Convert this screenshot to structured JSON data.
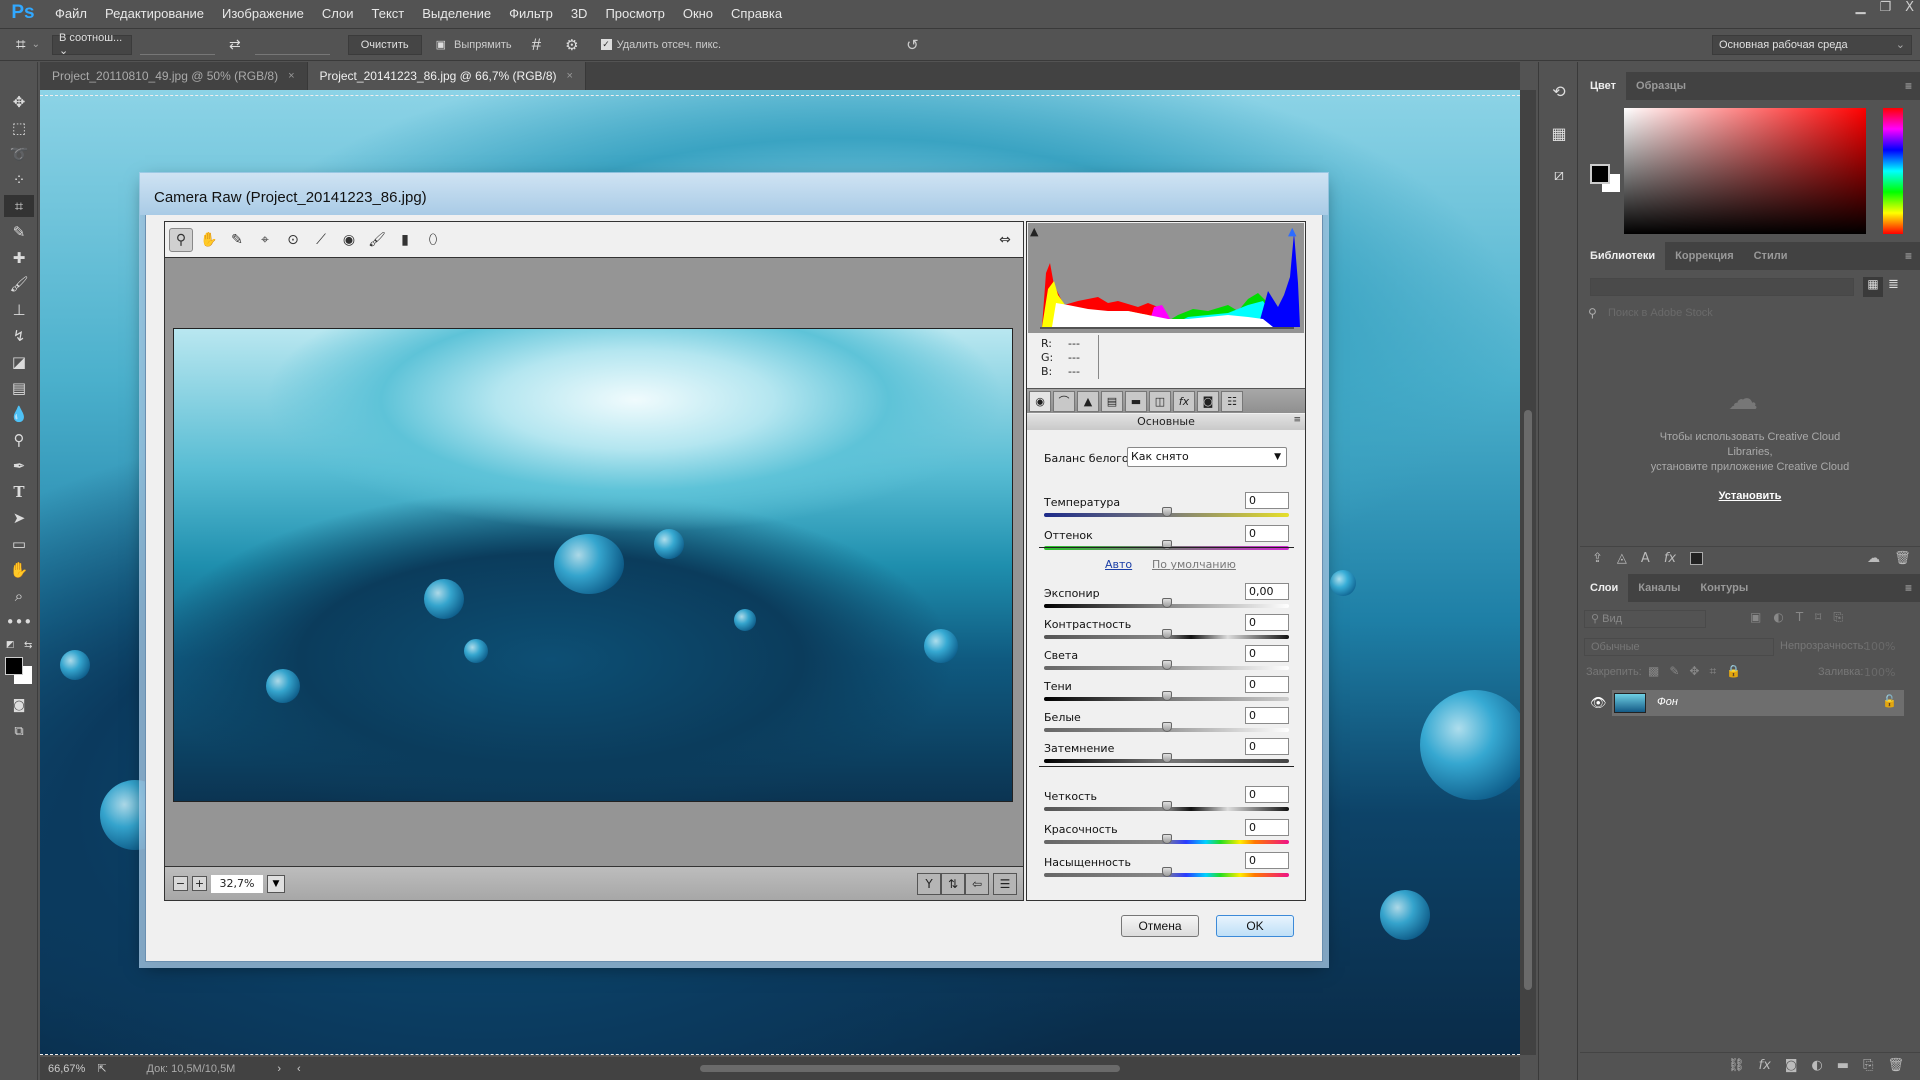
{
  "app": {
    "logo": "Ps"
  },
  "menu": [
    "Файл",
    "Редактирование",
    "Изображение",
    "Слои",
    "Текст",
    "Выделение",
    "Фильтр",
    "3D",
    "Просмотр",
    "Окно",
    "Справка"
  ],
  "window_controls": {
    "minimize": "▁",
    "restore": "❐",
    "close": "X"
  },
  "options": {
    "ratio_select": "В соотнош... ⌄",
    "clear_label": "Очистить",
    "straighten_label": "Выпрямить",
    "delete_cropped_label": "Удалить отсеч. пикс.",
    "delete_cropped_checked": true,
    "workspace": "Основная рабочая среда"
  },
  "tabs": [
    {
      "label": "Project_20110810_49.jpg @ 50% (RGB/8)",
      "close": "×",
      "active": false
    },
    {
      "label": "Project_20141223_86.jpg @ 66,7% (RGB/8)",
      "close": "×",
      "active": true
    }
  ],
  "tools": [
    "move",
    "marquee",
    "lasso",
    "quick-select",
    "crop",
    "eyedropper",
    "healing",
    "brush",
    "stamp",
    "history-brush",
    "eraser",
    "gradient",
    "blur",
    "dodge",
    "pen",
    "type",
    "path-select",
    "rectangle",
    "hand",
    "zoom",
    "more"
  ],
  "status": {
    "zoom": "66,67%",
    "doc": "Док: 10,5M/10,5M",
    "next": "›",
    "prev": "‹"
  },
  "color_panel": {
    "tabs": [
      "Цвет",
      "Образцы"
    ],
    "foreground": "#000000",
    "background": "#ffffff",
    "hue": "#ff0000"
  },
  "libraries_panel": {
    "tabs": [
      "Библиотеки",
      "Коррекция",
      "Стили"
    ],
    "search_placeholder": "Поиск в Adobe Stock",
    "message_line1": "Чтобы использовать Creative Cloud",
    "message_line2": "Libraries,",
    "message_line3": "установите приложение Creative Cloud",
    "install_label": "Установить"
  },
  "layers_panel": {
    "tabs": [
      "Слои",
      "Каналы",
      "Контуры"
    ],
    "filter_placeholder": "Вид",
    "blend_mode": "Обычные",
    "opacity_label": "Непрозрачность:",
    "opacity_value": "100%",
    "lock_label": "Закрепить:",
    "fill_label": "Заливка:",
    "fill_value": "100%",
    "layers": [
      {
        "name": "Фон",
        "visible": true,
        "locked": true
      }
    ]
  },
  "camera_raw": {
    "title": "Camera Raw (Project_20141223_86.jpg)",
    "zoom_value": "32,7%",
    "rgb": {
      "r_label": "R:",
      "g_label": "G:",
      "b_label": "B:",
      "r": "---",
      "g": "---",
      "b": "---"
    },
    "panel_title": "Основные",
    "white_balance_label": "Баланс белого:",
    "white_balance_value": "Как снято",
    "auto_label": "Авто",
    "default_label": "По умолчанию",
    "sliders": [
      {
        "label": "Температура",
        "value": "0",
        "position": 0.5
      },
      {
        "label": "Оттенок",
        "value": "0",
        "position": 0.5
      },
      {
        "label": "Экспонир",
        "value": "0,00",
        "position": 0.5
      },
      {
        "label": "Контрастность",
        "value": "0",
        "position": 0.5
      },
      {
        "label": "Света",
        "value": "0",
        "position": 0.5
      },
      {
        "label": "Тени",
        "value": "0",
        "position": 0.5
      },
      {
        "label": "Белые",
        "value": "0",
        "position": 0.5
      },
      {
        "label": "Затемнение",
        "value": "0",
        "position": 0.5
      },
      {
        "label": "Четкость",
        "value": "0",
        "position": 0.5
      },
      {
        "label": "Красочность",
        "value": "0",
        "position": 0.5
      },
      {
        "label": "Насыщенность",
        "value": "0",
        "position": 0.5
      }
    ],
    "cancel_label": "Отмена",
    "ok_label": "OK"
  }
}
